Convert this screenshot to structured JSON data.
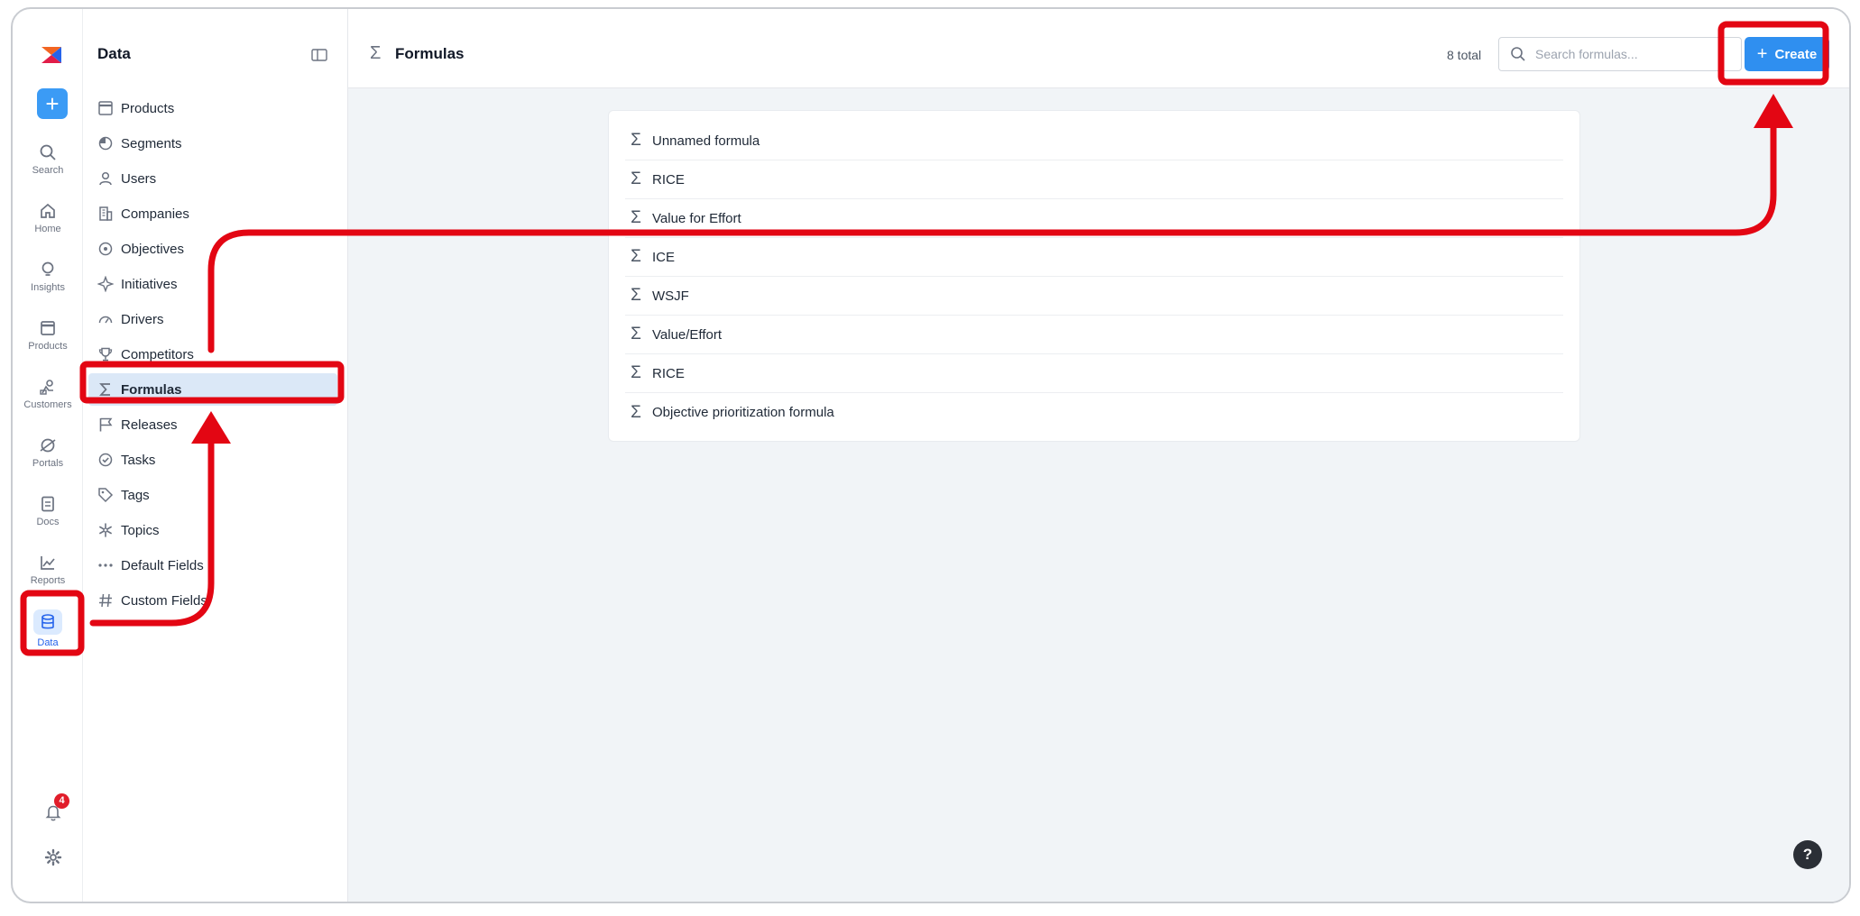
{
  "rail": {
    "items": [
      {
        "label": "Search",
        "icon": "search-icon"
      },
      {
        "label": "Home",
        "icon": "home-icon"
      },
      {
        "label": "Insights",
        "icon": "lightbulb-icon"
      },
      {
        "label": "Products",
        "icon": "window-icon"
      },
      {
        "label": "Customers",
        "icon": "customers-icon"
      },
      {
        "label": "Portals",
        "icon": "portal-icon"
      },
      {
        "label": "Docs",
        "icon": "doc-icon"
      },
      {
        "label": "Reports",
        "icon": "chart-icon"
      },
      {
        "label": "Data",
        "icon": "database-icon"
      }
    ],
    "notification_count": "4"
  },
  "sidebar": {
    "title": "Data",
    "items": [
      {
        "label": "Products",
        "icon": "window-icon"
      },
      {
        "label": "Segments",
        "icon": "pie-icon"
      },
      {
        "label": "Users",
        "icon": "user-icon"
      },
      {
        "label": "Companies",
        "icon": "building-icon"
      },
      {
        "label": "Objectives",
        "icon": "target-icon"
      },
      {
        "label": "Initiatives",
        "icon": "sparkle-icon"
      },
      {
        "label": "Drivers",
        "icon": "gauge-icon"
      },
      {
        "label": "Competitors",
        "icon": "trophy-icon"
      },
      {
        "label": "Formulas",
        "icon": "sigma-icon"
      },
      {
        "label": "Releases",
        "icon": "flag-icon"
      },
      {
        "label": "Tasks",
        "icon": "check-circle-icon"
      },
      {
        "label": "Tags",
        "icon": "tag-icon"
      },
      {
        "label": "Topics",
        "icon": "asterisk-icon"
      },
      {
        "label": "Default Fields",
        "icon": "dots-icon"
      },
      {
        "label": "Custom Fields",
        "icon": "hash-icon"
      }
    ]
  },
  "header": {
    "title": "Formulas",
    "total": "8 total",
    "search_placeholder": "Search formulas...",
    "create_label": "Create"
  },
  "formulas": [
    "Unnamed formula",
    "RICE",
    "Value for Effort",
    "ICE",
    "WSJF",
    "Value/Effort",
    "RICE",
    "Objective prioritization formula"
  ],
  "help_label": "?",
  "colors": {
    "accent": "#2f8ff0",
    "annotation": "#e30613",
    "active_bg": "#dbe8f7"
  }
}
